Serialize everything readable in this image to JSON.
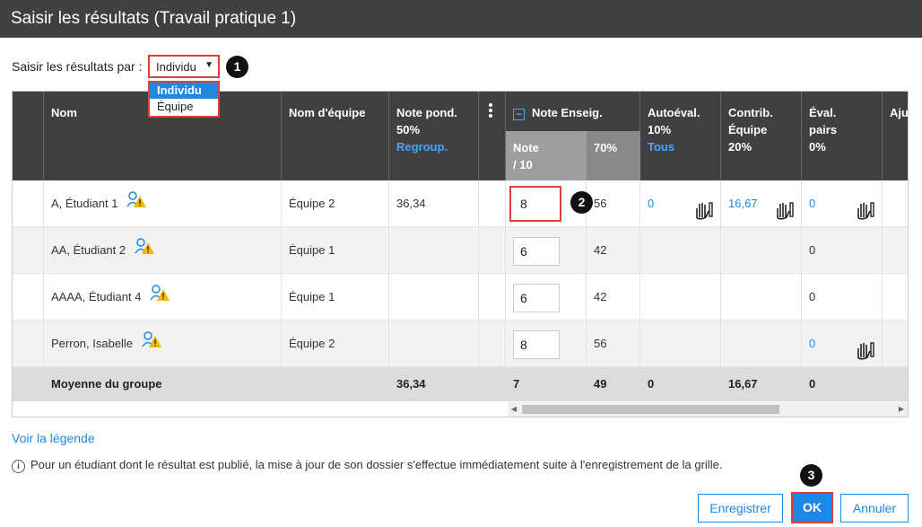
{
  "title": "Saisir les résultats (Travail pratique 1)",
  "mode": {
    "label": "Saisir les résultats par :",
    "selected": "Individu",
    "options": [
      "Individu",
      "Équipe"
    ]
  },
  "steps": [
    "1",
    "2",
    "3"
  ],
  "columns": {
    "nom": "Nom",
    "equipe": "Nom d'équipe",
    "note_pond": [
      "Note pond.",
      "50%"
    ],
    "note_pond_link": "Regroup.",
    "note_enseig": "Note Enseig.",
    "note_sub": [
      "Note",
      "/ 10"
    ],
    "pct_sub": "70%",
    "autoeval": [
      "Autoéval.",
      "10%"
    ],
    "autoeval_link": "Tous",
    "contrib": [
      "Contrib.",
      "Équipe",
      "20%"
    ],
    "eval_pairs": [
      "Éval.",
      "pairs",
      "0%"
    ],
    "cut": "Aju"
  },
  "rows": [
    {
      "nom": "A, Étudiant 1",
      "equipe": "Équipe 2",
      "pond": "36,34",
      "note": "8",
      "pct": "56",
      "auto": "0",
      "contrib": "16,67",
      "pairs": "0"
    },
    {
      "nom": "AA, Étudiant 2",
      "equipe": "Équipe 1",
      "pond": "",
      "note": "6",
      "pct": "42",
      "auto": "",
      "contrib": "",
      "pairs": "0"
    },
    {
      "nom": "AAAA, Étudiant 4",
      "equipe": "Équipe 1",
      "pond": "",
      "note": "6",
      "pct": "42",
      "auto": "",
      "contrib": "",
      "pairs": "0"
    },
    {
      "nom": "Perron, Isabelle",
      "equipe": "Équipe 2",
      "pond": "",
      "note": "8",
      "pct": "56",
      "auto": "",
      "contrib": "",
      "pairs": "0"
    }
  ],
  "average": {
    "label": "Moyenne du groupe",
    "pond": "36,34",
    "note": "7",
    "pct": "49",
    "auto": "0",
    "contrib": "16,67",
    "pairs": "0"
  },
  "legend_link": "Voir la légende",
  "info_text": "Pour un étudiant dont le résultat est publié, la mise à jour de son dossier s'effectue immédiatement suite à l'enregistrement de la grille.",
  "buttons": {
    "save": "Enregistrer",
    "ok": "OK",
    "cancel": "Annuler"
  },
  "colors": {
    "accent": "#1e88e5",
    "highlight": "#e03c3c",
    "header": "#404040"
  }
}
